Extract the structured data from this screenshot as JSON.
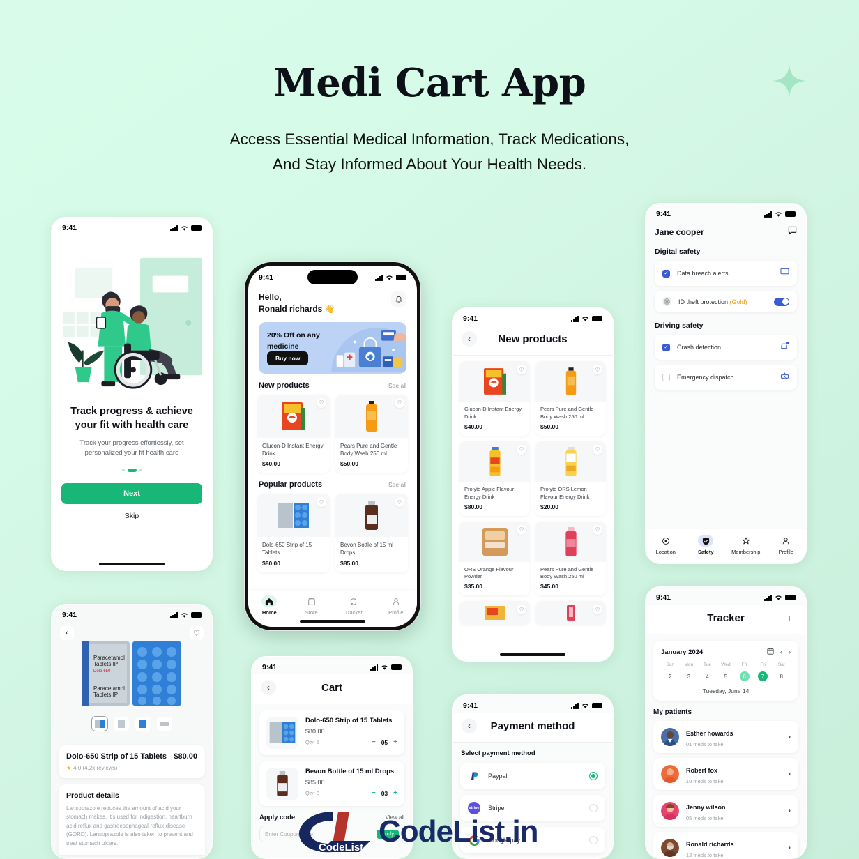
{
  "hero": {
    "title": "Medi Cart App",
    "subtitle_line1": "Access Essential Medical Information, Track Medications,",
    "subtitle_line2": "And Stay Informed About Your Health Needs."
  },
  "colors": {
    "background_top": "#d8fce9",
    "background_bottom": "#c9efdb",
    "accent_green": "#17b877",
    "accent_blue": "#3b5bd6",
    "gold": "#e8a020",
    "promo_bg": "#bcd3f5"
  },
  "status_bar": {
    "time": "9:41"
  },
  "onboarding": {
    "title": "Track progress & achieve your fit with health care",
    "description": "Track your progress effortlessly, set personalized your fit health care",
    "next_label": "Next",
    "skip_label": "Skip",
    "dots": 3,
    "active_dot": 1
  },
  "product_detail": {
    "name": "Dolo-650 Strip of 15 Tablets",
    "price": "$80.00",
    "rating": "4.0 (4.2k reviews)",
    "details_heading": "Product details",
    "details_text": "Lansoprazole reduces the amount of acid your stomach makes. It's used for indigestion, heartburn acid reflux and gastroesophageal-reflux-disease (GORD). Lansoprazole is also taken to prevent and treat stomach ulcers."
  },
  "home": {
    "greeting_line1": "Hello,",
    "greeting_line2": "Ronald richards 👋",
    "promo_title": "20% Off on any medicine",
    "promo_button": "Buy now",
    "section_new": "New products",
    "section_popular": "Popular products",
    "see_all": "See all",
    "new_products": [
      {
        "name": "Glucon-D Instant Energy Drink",
        "price": "$40.00"
      },
      {
        "name": "Pears Pure and Gentle Body Wash 250 ml",
        "price": "$50.00"
      }
    ],
    "popular_products": [
      {
        "name": "Dolo-650 Strip of 15 Tablets",
        "price": "$80.00"
      },
      {
        "name": "Bevon Bottle of 15 ml Drops",
        "price": "$85.00"
      }
    ],
    "tabs": [
      {
        "label": "Home",
        "icon": "home-icon",
        "active": true
      },
      {
        "label": "Store",
        "icon": "store-icon",
        "active": false
      },
      {
        "label": "Tracker",
        "icon": "refresh-icon",
        "active": false
      },
      {
        "label": "Profile",
        "icon": "person-icon",
        "active": false
      }
    ]
  },
  "new_products_screen": {
    "title": "New products",
    "items": [
      {
        "name": "Glucon-D Instant Energy Drink",
        "price": "$40.00"
      },
      {
        "name": "Pears Pure and Gentle Body Wash 250 ml",
        "price": "$50.00"
      },
      {
        "name": "Prolyte Apple Flavour Energy Drink",
        "price": "$80.00"
      },
      {
        "name": "Prolyte ORS Lemon Flavour Energy Drink",
        "price": "$20.00"
      },
      {
        "name": "ORS Orange Flavour Powder",
        "price": "$35.00"
      },
      {
        "name": "Pears Pure and Gentle Body Wash 250 ml",
        "price": "$45.00"
      }
    ]
  },
  "cart": {
    "title": "Cart",
    "items": [
      {
        "name": "Dolo-650 Strip of 15 Tablets",
        "price": "$80.00",
        "qty_label": "Qty: 5",
        "qty": "05"
      },
      {
        "name": "Bevon Bottle of 15 ml Drops",
        "price": "$85.00",
        "qty_label": "Qty: 3",
        "qty": "03"
      }
    ],
    "coupon_heading": "Apply code",
    "view_all": "View all",
    "coupon_placeholder": "Enter Coupon code",
    "apply_label": "Apply"
  },
  "payment": {
    "title": "Payment method",
    "section_label": "Select payment method",
    "methods": [
      {
        "name": "Paypal",
        "icon": "paypal-icon",
        "selected": true
      },
      {
        "name": "Stripe",
        "icon": "stripe-icon",
        "selected": false
      },
      {
        "name": "Google pay",
        "icon": "google-icon",
        "selected": false
      }
    ]
  },
  "safety": {
    "user_name": "Jane cooper",
    "section_digital": "Digital safety",
    "section_driving": "Driving safety",
    "digital_items": [
      {
        "label": "Data breach alerts",
        "checked": true,
        "control": "checkbox",
        "icon": "monitor-icon"
      },
      {
        "label": "ID theft protection ",
        "badge": "(Gold)",
        "checked": true,
        "control": "toggle",
        "icon": "fingerprint-icon"
      }
    ],
    "driving_items": [
      {
        "label": "Crash detection",
        "checked": true,
        "control": "checkbox",
        "icon": "car-alert-icon"
      },
      {
        "label": "Emergency dispatch",
        "checked": false,
        "control": "checkbox",
        "icon": "ambulance-icon"
      }
    ],
    "tabs": [
      {
        "label": "Location",
        "icon": "location-icon",
        "active": false
      },
      {
        "label": "Safety",
        "icon": "shield-icon",
        "active": true
      },
      {
        "label": "Membership",
        "icon": "star-icon",
        "active": false
      },
      {
        "label": "Profile",
        "icon": "person-icon",
        "active": false
      }
    ]
  },
  "tracker": {
    "title": "Tracker",
    "month": "January 2024",
    "day_names": [
      "Sun",
      "Mon",
      "Tue",
      "Wed",
      "Fri",
      "Fri",
      "Sat"
    ],
    "day_numbers": [
      "2",
      "3",
      "4",
      "5",
      "6",
      "7",
      "8"
    ],
    "soft_day_index": 4,
    "selected_day_index": 5,
    "selected_date_label": "Tuesday, June 14",
    "patients_heading": "My patients",
    "patients": [
      {
        "name": "Esther howards",
        "sub": "01 meds to take",
        "avatar": "#4a6fa8"
      },
      {
        "name": "Robert fox",
        "sub": "10 meds to take",
        "avatar": "#ef6a3a"
      },
      {
        "name": "Jenny wilson",
        "sub": "05 meds to take",
        "avatar": "#e8426f"
      },
      {
        "name": "Ronald richards",
        "sub": "12 meds to take",
        "avatar": "#7d4a30"
      }
    ]
  },
  "watermark": {
    "text": "CodeList.in",
    "logo_text": "CodeList"
  }
}
